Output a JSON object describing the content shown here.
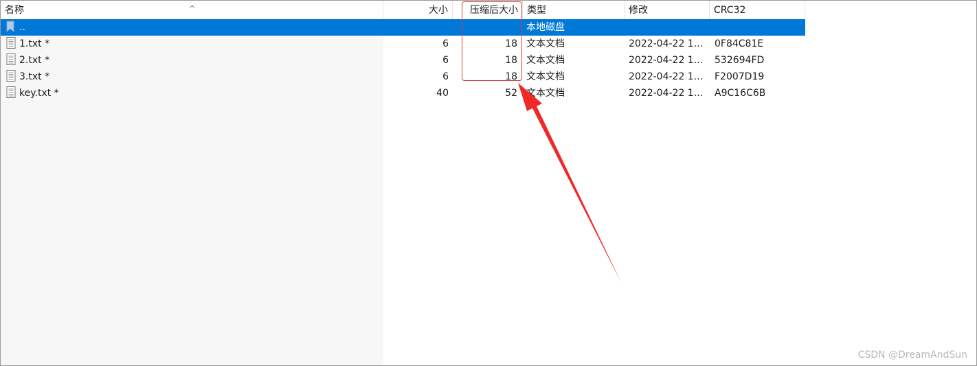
{
  "columns": {
    "name": "名称",
    "size": "大小",
    "compressed": "压缩后大小",
    "type": "类型",
    "modified": "修改",
    "crc": "CRC32"
  },
  "rows": [
    {
      "name": "..",
      "size": "",
      "compressed": "",
      "type": "本地磁盘",
      "modified": "",
      "crc": "",
      "icon": "folder-up-icon",
      "selected": true
    },
    {
      "name": "1.txt *",
      "size": "6",
      "compressed": "18",
      "type": "文本文档",
      "modified": "2022-04-22 1...",
      "crc": "0F84C81E",
      "icon": "text-file-icon",
      "selected": false
    },
    {
      "name": "2.txt *",
      "size": "6",
      "compressed": "18",
      "type": "文本文档",
      "modified": "2022-04-22 1...",
      "crc": "532694FD",
      "icon": "text-file-icon",
      "selected": false
    },
    {
      "name": "3.txt *",
      "size": "6",
      "compressed": "18",
      "type": "文本文档",
      "modified": "2022-04-22 1...",
      "crc": "F2007D19",
      "icon": "text-file-icon",
      "selected": false
    },
    {
      "name": "key.txt *",
      "size": "40",
      "compressed": "52",
      "type": "文本文档",
      "modified": "2022-04-22 1...",
      "crc": "A9C16C6B",
      "icon": "text-file-icon",
      "selected": false
    }
  ],
  "watermark": "CSDN @DreamAndSun",
  "colors": {
    "selection": "#0078d7",
    "annotation": "#e63b3b"
  }
}
